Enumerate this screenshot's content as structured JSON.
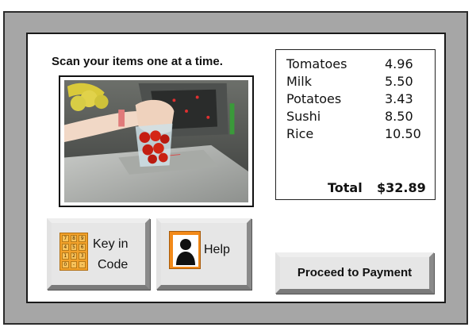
{
  "screen": {
    "instruction": "Scan your items one at a time."
  },
  "camera_feed": {
    "icon": "checkout-scanner-photo"
  },
  "receipt": {
    "items": [
      {
        "name": "Tomatoes",
        "price": "4.96"
      },
      {
        "name": "Milk",
        "price": "5.50"
      },
      {
        "name": "Potatoes",
        "price": "3.43"
      },
      {
        "name": "Sushi",
        "price": "8.50"
      },
      {
        "name": "Rice",
        "price": "10.50"
      }
    ],
    "total_label": "Total",
    "total_value": "$32.89"
  },
  "buttons": {
    "key_in_code": {
      "line1": "Key in",
      "line2": "Code",
      "icon": "keypad-icon",
      "keys": [
        "7",
        "8",
        "9",
        "4",
        "5",
        "6",
        "1",
        "2",
        "3",
        "0",
        "-",
        "-"
      ]
    },
    "help": {
      "label": "Help",
      "icon": "person-icon"
    },
    "proceed": {
      "label": "Proceed to Payment"
    }
  },
  "colors": {
    "bezel": "#a6a6a6",
    "screen": "#ffffff",
    "button_face": "#e6e6e6",
    "keypad_orange": "#f2a12a",
    "help_orange": "#f28a1a"
  }
}
